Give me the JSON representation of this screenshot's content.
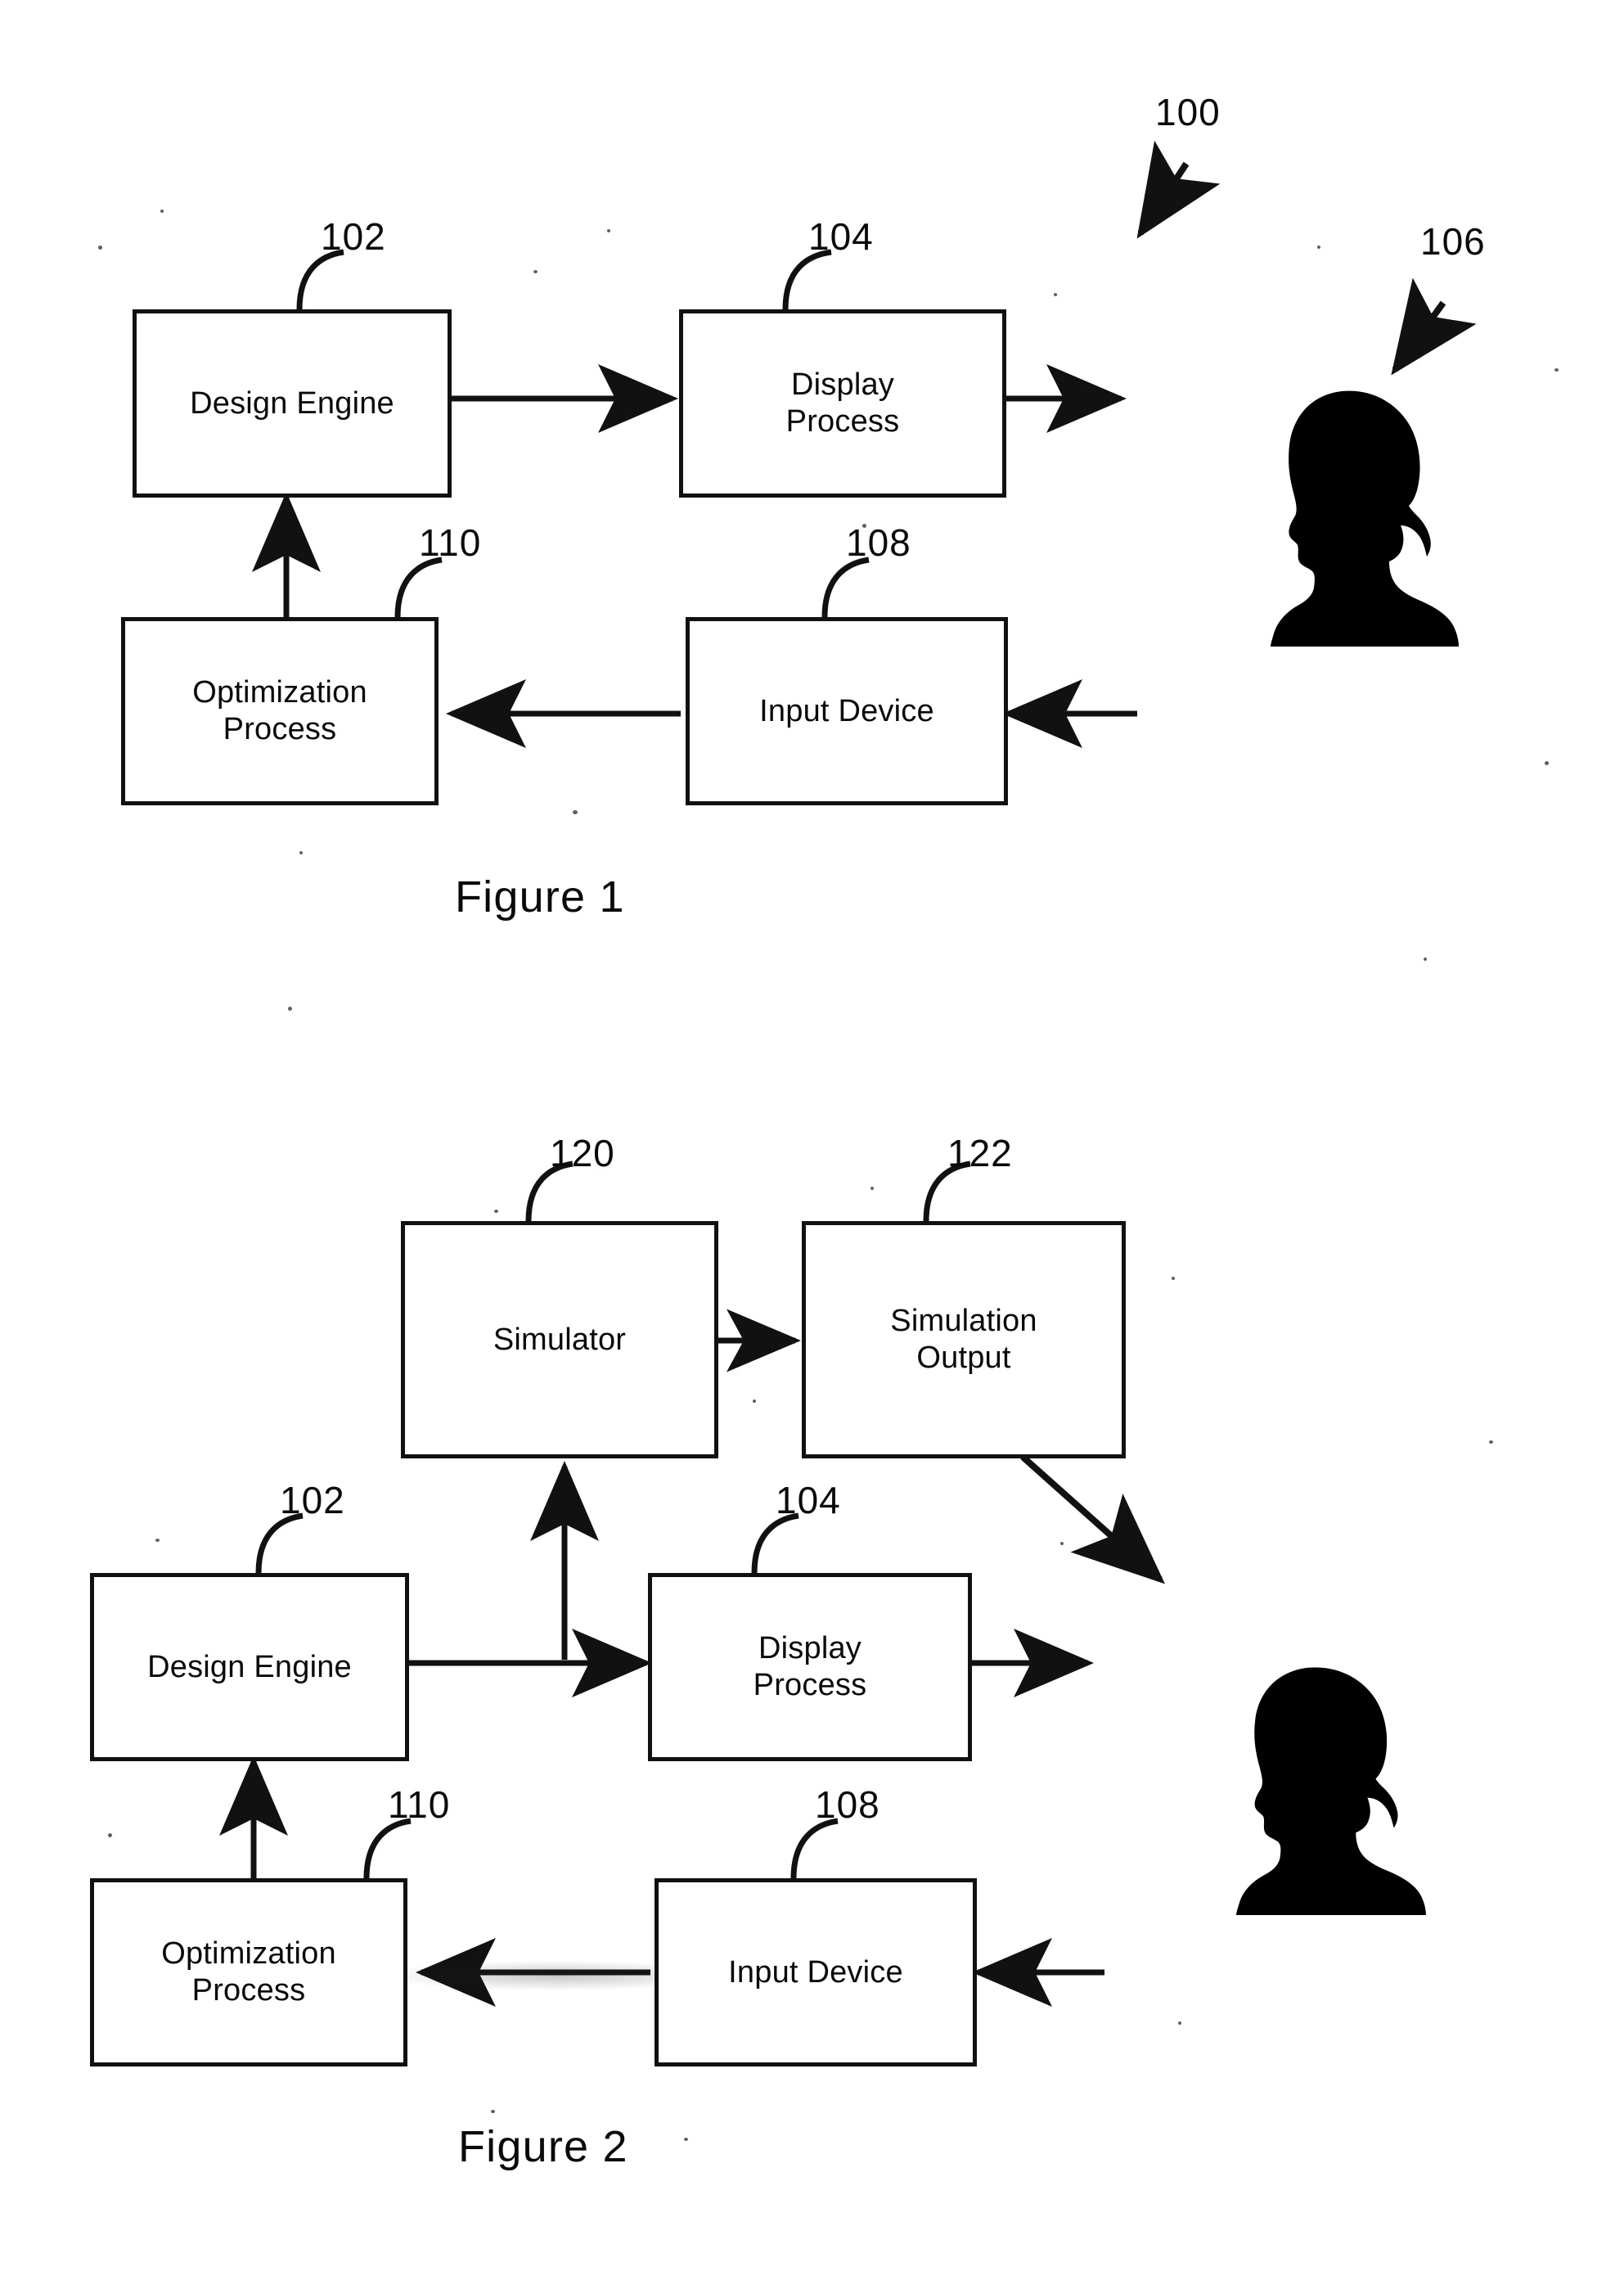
{
  "document": {
    "type": "patent-drawing-sheet",
    "background_color": "#ffffff",
    "ink_color": "#000000"
  },
  "figures": [
    {
      "id": "figure-1",
      "caption": "Figure 1",
      "system_ref": "100",
      "nodes": [
        {
          "id": "design-engine",
          "label": "Design Engine",
          "ref": "102"
        },
        {
          "id": "display-process",
          "label_line1": "Display",
          "label_line2": "Process",
          "ref": "104"
        },
        {
          "id": "optimization-process",
          "label_line1": "Optimization",
          "label_line2": "Process",
          "ref": "110"
        },
        {
          "id": "input-device",
          "label": "Input Device",
          "ref": "108"
        },
        {
          "id": "user",
          "label": "user-silhouette",
          "ref": "106"
        }
      ],
      "connections": [
        {
          "from": "design-engine",
          "to": "display-process",
          "direction": "right"
        },
        {
          "from": "display-process",
          "to": "user",
          "direction": "right"
        },
        {
          "from": "external",
          "to": "input-device",
          "direction": "left"
        },
        {
          "from": "input-device",
          "to": "optimization-process",
          "direction": "left"
        },
        {
          "from": "optimization-process",
          "to": "design-engine",
          "direction": "up"
        }
      ]
    },
    {
      "id": "figure-2",
      "caption": "Figure 2",
      "nodes": [
        {
          "id": "simulator",
          "label": "Simulator",
          "ref": "120"
        },
        {
          "id": "simulation-output",
          "label_line1": "Simulation",
          "label_line2": "Output",
          "ref": "122"
        },
        {
          "id": "design-engine",
          "label": "Design Engine",
          "ref": "102"
        },
        {
          "id": "display-process",
          "label_line1": "Display",
          "label_line2": "Process",
          "ref": "104"
        },
        {
          "id": "optimization-process",
          "label_line1": "Optimization",
          "label_line2": "Process",
          "ref": "110"
        },
        {
          "id": "input-device",
          "label": "Input Device",
          "ref": "108"
        },
        {
          "id": "user",
          "label": "user-silhouette",
          "ref": ""
        }
      ],
      "connections": [
        {
          "from": "simulator",
          "to": "simulation-output",
          "direction": "right"
        },
        {
          "from": "simulation-output",
          "to": "user",
          "direction": "diagonal-down-right"
        },
        {
          "from": "design-engine",
          "to": "simulator",
          "direction": "up"
        },
        {
          "from": "design-engine",
          "to": "display-process",
          "direction": "right"
        },
        {
          "from": "display-process",
          "to": "user",
          "direction": "right"
        },
        {
          "from": "external",
          "to": "input-device",
          "direction": "left"
        },
        {
          "from": "input-device",
          "to": "optimization-process",
          "direction": "left"
        },
        {
          "from": "optimization-process",
          "to": "design-engine",
          "direction": "up"
        }
      ]
    }
  ],
  "fig1": {
    "ref_100": "100",
    "ref_102": "102",
    "ref_104": "104",
    "ref_106": "106",
    "ref_108": "108",
    "ref_110": "110",
    "design_engine": "Design Engine",
    "display_l1": "Display",
    "display_l2": "Process",
    "optimization_l1": "Optimization",
    "optimization_l2": "Process",
    "input_device": "Input Device",
    "caption": "Figure 1"
  },
  "fig2": {
    "ref_102": "102",
    "ref_104": "104",
    "ref_108": "108",
    "ref_110": "110",
    "ref_120": "120",
    "ref_122": "122",
    "simulator": "Simulator",
    "sim_out_l1": "Simulation",
    "sim_out_l2": "Output",
    "design_engine": "Design Engine",
    "display_l1": "Display",
    "display_l2": "Process",
    "optimization_l1": "Optimization",
    "optimization_l2": "Process",
    "input_device": "Input Device",
    "caption": "Figure 2"
  }
}
